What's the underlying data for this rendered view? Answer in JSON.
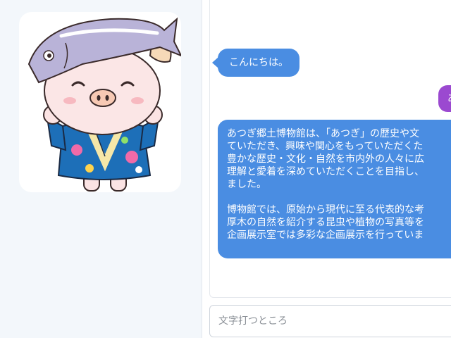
{
  "sidebar": {
    "avatar_label": "mascot-avatar"
  },
  "chat": {
    "messages": [
      {
        "from": "bot",
        "text": "こんにちは。"
      },
      {
        "from": "user",
        "text": "あ"
      },
      {
        "from": "bot",
        "text": "あつぎ郷土博物館は、「あつぎ」の歴史や文\nていただき、興味や関心をもっていただくた\n豊かな歴史・文化・自然を市内外の人々に広\n理解と愛着を深めていただくことを目指し、\nました。\n\n博物館では、原始から現代に至る代表的な考\n厚木の自然を紹介する昆虫や植物の写真等を\n企画展示室では多彩な企画展示を行っていま"
      }
    ]
  },
  "input": {
    "placeholder": "文字打つところ",
    "value": ""
  },
  "colors": {
    "bot_bubble": "#4a8de2",
    "user_bubble": "#9b49d0",
    "sidebar_bg": "#f3f7fb"
  }
}
